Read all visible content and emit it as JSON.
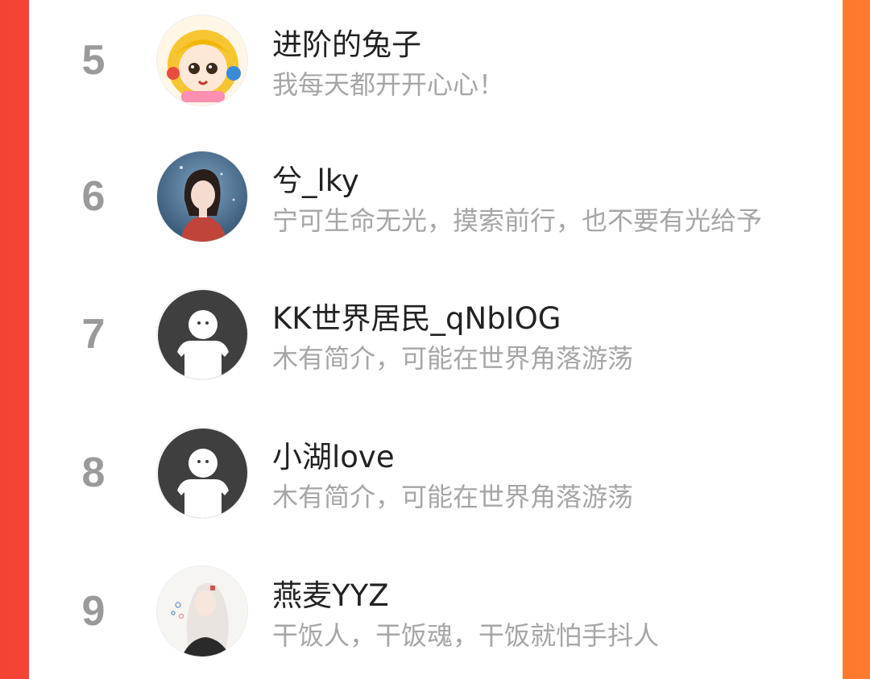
{
  "theme": {
    "accent_left": "#f44336",
    "accent_right": "#ff7a2e",
    "rank_color": "#9a9a9a",
    "name_color": "#222222",
    "bio_color": "#a6a6a6"
  },
  "leaderboard": {
    "items": [
      {
        "rank": "5",
        "name": "进阶的兔子",
        "bio": "我每天都开开心心！",
        "avatar": "anime-girl-blonde-avatar"
      },
      {
        "rank": "6",
        "name": "兮_lky",
        "bio": "宁可生命无光，摸索前行，也不要有光给予",
        "avatar": "girl-red-dress-avatar"
      },
      {
        "rank": "7",
        "name": "KK世界居民_qNbIOG",
        "bio": "木有简介，可能在世界角落游荡",
        "avatar": "default-user-avatar"
      },
      {
        "rank": "8",
        "name": "小湖love",
        "bio": "木有简介，可能在世界角落游荡",
        "avatar": "default-user-avatar"
      },
      {
        "rank": "9",
        "name": "燕麦YYZ",
        "bio": "干饭人，干饭魂，干饭就怕手抖人",
        "avatar": "white-hair-girl-avatar"
      }
    ]
  }
}
